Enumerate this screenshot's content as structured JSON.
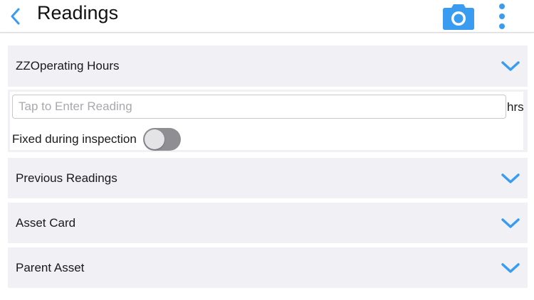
{
  "header": {
    "title": "Readings",
    "back_icon": "chevron-left-icon",
    "camera_icon": "camera-icon",
    "more_icon": "more-vertical-icon",
    "accent_color": "#3a9cf0"
  },
  "sections": {
    "operating_hours": {
      "label": "ZZOperating Hours",
      "expanded": true
    },
    "previous_readings": {
      "label": "Previous Readings",
      "expanded": false
    },
    "asset_card": {
      "label": "Asset Card",
      "expanded": false
    },
    "parent_asset": {
      "label": "Parent Asset",
      "expanded": false
    }
  },
  "reading": {
    "value": "",
    "placeholder": "Tap to Enter Reading",
    "unit": "hrs",
    "fixed_label": "Fixed during inspection",
    "fixed_on": false
  }
}
